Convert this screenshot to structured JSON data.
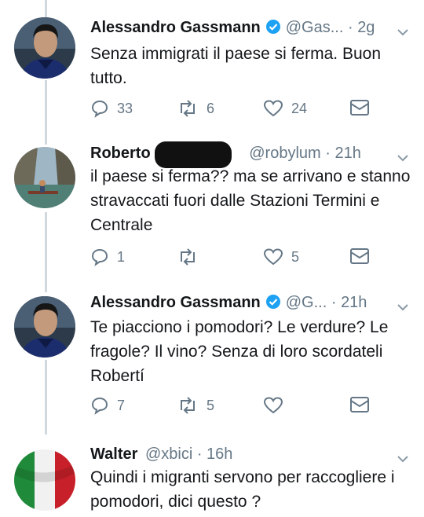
{
  "tweets": [
    {
      "name": "Alessandro Gassmann",
      "handle": "@Gas...",
      "time": "2g",
      "text": "Senza immigrati il paese si ferma. Buon tutto.",
      "replies": "33",
      "retweets": "6",
      "likes": "24",
      "verified": true,
      "avatar": "man-portrait-dark"
    },
    {
      "name": "Roberto",
      "handle": "@robylum",
      "time": "21h",
      "text": "il paese si ferma?? ma se arrivano e stanno stravaccati fuori dalle Stazioni Termini e Centrale",
      "replies": "1",
      "retweets": "",
      "likes": "5",
      "verified": false,
      "avatar": "canyon-river-kayaker"
    },
    {
      "name": "Alessandro Gassmann",
      "handle": "@G...",
      "time": "21h",
      "text": "Te piacciono i pomodori? Le verdure? Le fragole? Il vino? Senza di loro scordateli Robertí",
      "replies": "7",
      "retweets": "5",
      "likes": "",
      "verified": true,
      "avatar": "man-portrait-dark"
    },
    {
      "name": "Walter",
      "handle": "@xbici",
      "time": "16h",
      "text": "Quindi i migranti servono per raccogliere i pomodori, dici questo ?",
      "verified": false,
      "avatar": "italian-flag"
    }
  ],
  "colors": {
    "text": "#14171a",
    "muted": "#657786",
    "verified": "#1da1f2",
    "thread_line": "#cfd9de"
  },
  "separator": " · "
}
